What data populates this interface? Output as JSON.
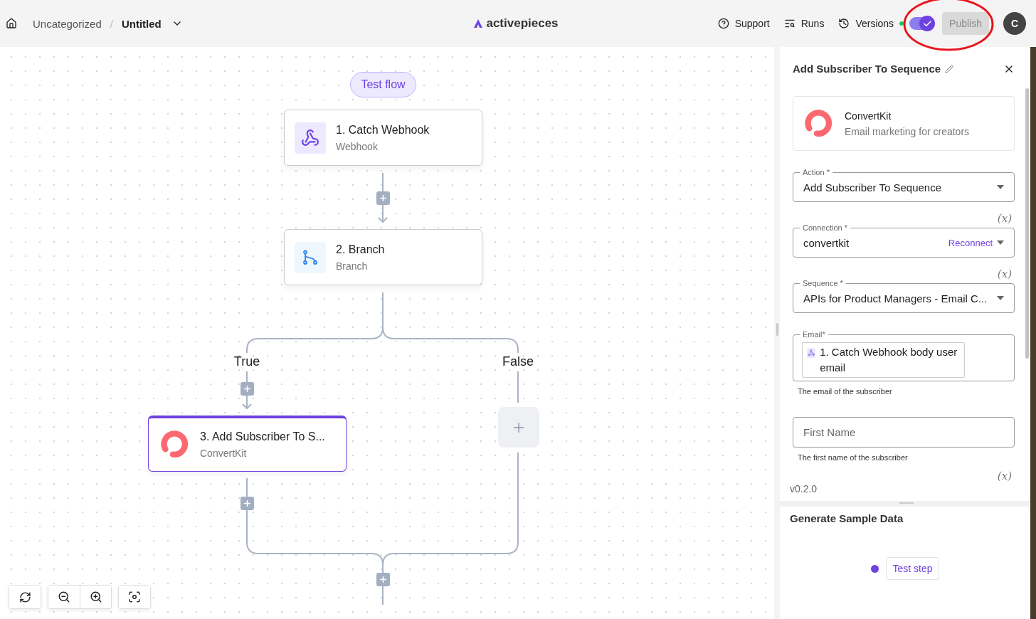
{
  "header": {
    "breadcrumb": "Uncategorized",
    "separator": "/",
    "flow_name": "Untitled",
    "logo": "activepieces",
    "nav": [
      {
        "kind": "support",
        "label": "Support",
        "status_dot": false
      },
      {
        "kind": "runs",
        "label": "Runs",
        "status_dot": false
      },
      {
        "kind": "versions",
        "label": "Versions",
        "status_dot": true
      }
    ],
    "toggle": {
      "on": true
    },
    "publish": {
      "label": "Publish",
      "disabled": true
    },
    "avatar": "C"
  },
  "canvas": {
    "test_flow": "Test flow",
    "branch_labels": [
      "True",
      "False"
    ],
    "steps": [
      {
        "kind": "webhook",
        "title": "1. Catch Webhook",
        "subtitle": "Webhook",
        "selected": false
      },
      {
        "kind": "branch",
        "title": "2. Branch",
        "subtitle": "Branch",
        "selected": false
      },
      {
        "kind": "convertkit",
        "title": "3. Add Subscriber To S...",
        "subtitle": "ConvertKit",
        "selected": true
      }
    ]
  },
  "panel": {
    "title": "Add Subscriber To Sequence",
    "piece": {
      "name": "ConvertKit",
      "description": "Email marketing for creators"
    },
    "fields": [
      {
        "kind": "select",
        "label": "Action *",
        "value": "Add Subscriber To Sequence"
      },
      {
        "kind": "select",
        "label": "Connection *",
        "value": "convertkit",
        "toggle": "(x)",
        "action": "Reconnect"
      },
      {
        "kind": "select",
        "label": "Sequence *",
        "value": "APIs for Product Managers - Email C...",
        "toggle": "(x)"
      },
      {
        "kind": "chip",
        "label": "Email*",
        "value": "1. Catch Webhook body user email",
        "hint": "The email of the subscriber"
      },
      {
        "kind": "text",
        "placeholder": "First Name",
        "hint": "The first name of the subscriber"
      }
    ],
    "trailing_toggle": "(x)",
    "version": "v0.2.0",
    "sample": {
      "title": "Generate Sample Data",
      "button": "Test step"
    }
  }
}
